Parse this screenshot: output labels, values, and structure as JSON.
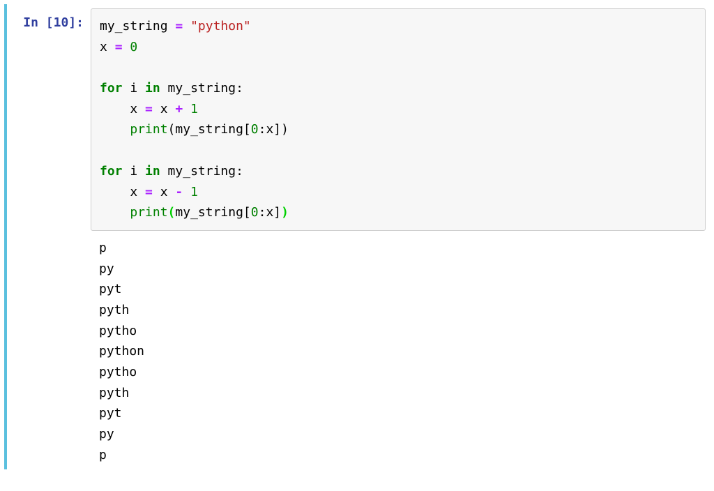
{
  "cell": {
    "prompt_label": "In [10]:",
    "code": {
      "l1": {
        "a": "my_string ",
        "op_eq": "=",
        "b": " ",
        "str": "\"python\""
      },
      "l2": {
        "a": "x ",
        "op_eq": "=",
        "b": " ",
        "num": "0"
      },
      "l3_blank": "",
      "l4": {
        "kw_for": "for",
        "sp1": " i ",
        "kw_in": "in",
        "sp2": " my_string:"
      },
      "l5": {
        "indent": "    x ",
        "op_eq": "=",
        "b": " x ",
        "op_plus": "+",
        "c": " ",
        "num": "1"
      },
      "l6": {
        "indent": "    ",
        "fn": "print",
        "open": "(",
        "args": "my_string[",
        "zero": "0",
        "colon_x": ":x])"
      },
      "l7_blank": "",
      "l8": {
        "kw_for": "for",
        "sp1": " i ",
        "kw_in": "in",
        "sp2": " my_string:"
      },
      "l9": {
        "indent": "    x ",
        "op_eq": "=",
        "b": " x ",
        "op_minus": "-",
        "c": " ",
        "num": "1"
      },
      "l10": {
        "indent": "    ",
        "fn": "print",
        "open": "(",
        "args": "my_string[",
        "zero": "0",
        "colon_x": ":x]",
        "close_cursor": ")"
      }
    },
    "output_lines": [
      "p",
      "py",
      "pyt",
      "pyth",
      "pytho",
      "python",
      "pytho",
      "pyth",
      "pyt",
      "py",
      "p"
    ]
  }
}
